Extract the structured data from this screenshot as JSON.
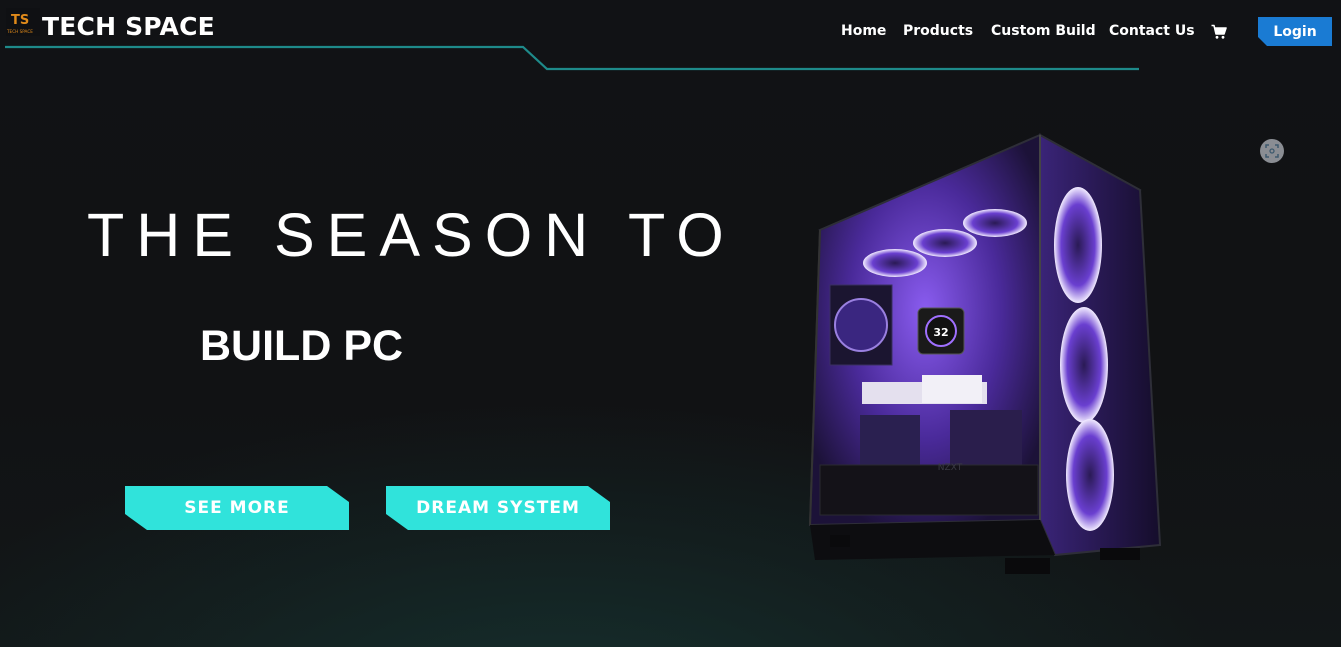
{
  "header": {
    "logo_text": "TS",
    "logo_subtext": "TECH SPACE",
    "brand": "TECH SPACE",
    "nav": [
      "Home",
      "Products",
      "Custom Build",
      "Contact Us"
    ],
    "cart_icon": "cart-icon",
    "login_label": "Login"
  },
  "hero": {
    "headline": "THE SEASON TO",
    "subheadline": "BUILD PC",
    "buttons": {
      "see_more": "SEE MORE",
      "dream_system": "DREAM SYSTEM"
    },
    "image": {
      "subject": "NZXT PC case with purple RGB fans",
      "fan_display_text": "32",
      "case_brand_text": "NZXT"
    },
    "zoom_icon": "expand-icon"
  },
  "colors": {
    "background": "#0f1013",
    "accent_teal": "#30e3db",
    "line_teal": "#1e8a8a",
    "login_blue": "#1a7bd3",
    "rgb_purple": "#7a4be0"
  }
}
